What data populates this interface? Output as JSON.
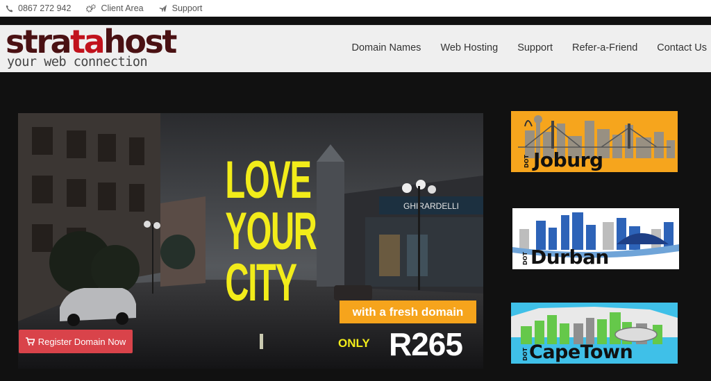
{
  "topbar": {
    "phone": "0867 272 942",
    "client_area": "Client Area",
    "support": "Support"
  },
  "logo": {
    "word_a": "stra",
    "word_b": "ta",
    "word_c": "host",
    "tagline": "your web connection"
  },
  "nav": {
    "items": [
      "Domain Names",
      "Web Hosting",
      "Support",
      "Refer-a-Friend",
      "Contact Us"
    ]
  },
  "hero": {
    "line1": "LOVE",
    "line2": "YOUR",
    "line3": "CITY",
    "fresh": "with a fresh domain",
    "only": "ONLY",
    "price": "R265",
    "register": "Register Domain Now",
    "shop_sign": "GHIRARDELLI"
  },
  "cards": {
    "joburg": {
      "prefix": "DOT",
      "name": "Joburg",
      "bg": "#f6a51d"
    },
    "durban": {
      "prefix": "DOT",
      "name": "Durban",
      "bg": "#ffffff"
    },
    "capetown": {
      "prefix": "DOT",
      "name": "CapeTown",
      "bg": "#3fc0e8"
    }
  },
  "colors": {
    "accent_red": "#d9434a",
    "headline_yellow": "#f2ec1a",
    "fresh_orange": "#f6a41c"
  }
}
